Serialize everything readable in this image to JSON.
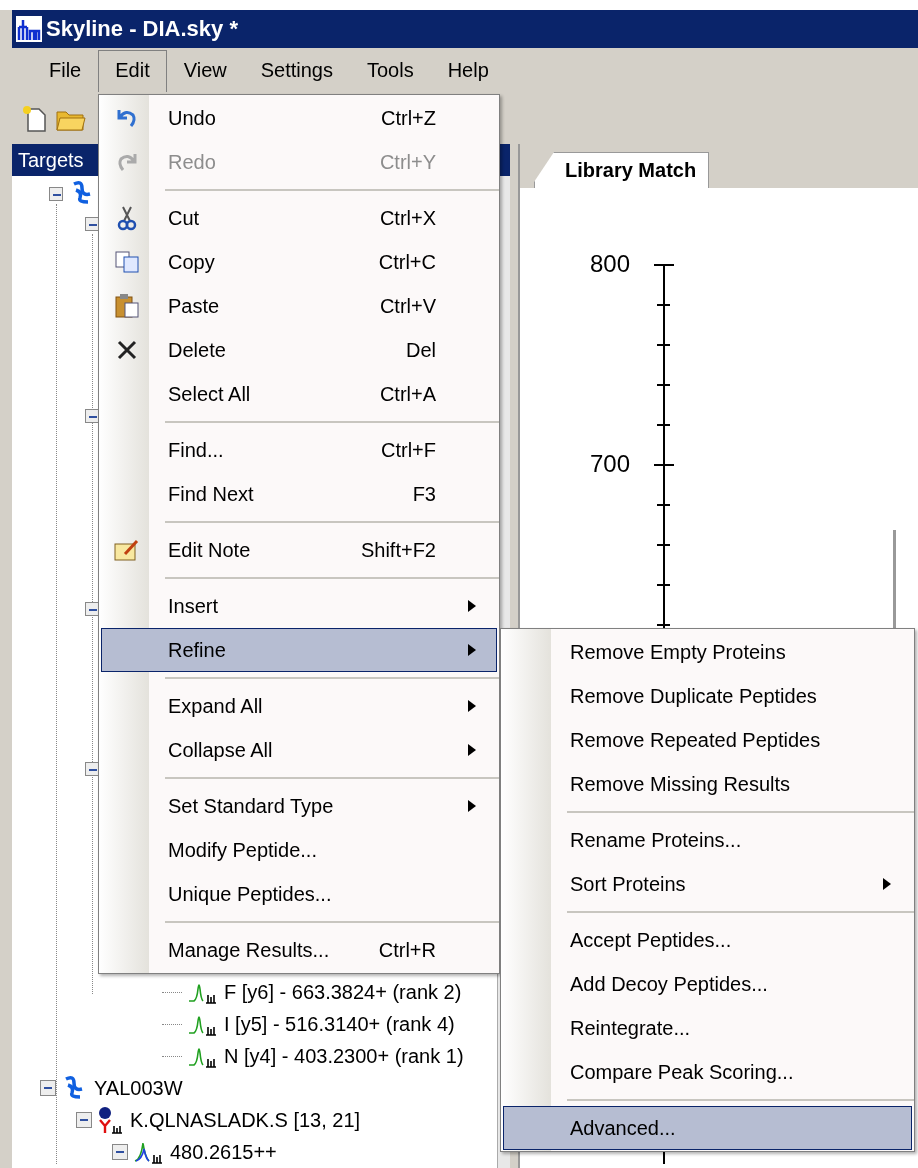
{
  "window": {
    "title": "Skyline - DIA.sky *"
  },
  "menu_bar": [
    {
      "label": "File",
      "selected": false
    },
    {
      "label": "Edit",
      "selected": true
    },
    {
      "label": "View",
      "selected": false
    },
    {
      "label": "Settings",
      "selected": false
    },
    {
      "label": "Tools",
      "selected": false
    },
    {
      "label": "Help",
      "selected": false
    }
  ],
  "targets_panel": {
    "title": "Targets",
    "tree": [
      {
        "kind": "transition",
        "label": "F [y6] - 663.3824+ (rank 2)"
      },
      {
        "kind": "transition",
        "label": "I [y5] - 516.3140+ (rank 4)"
      },
      {
        "kind": "transition",
        "label": "N [y4] - 403.2300+ (rank 1)"
      },
      {
        "kind": "protein",
        "label": "YAL003W",
        "expanded": true,
        "children": [
          {
            "kind": "peptide",
            "label": "K.QLNASLADK.S [13, 21]",
            "expanded": true,
            "children": [
              {
                "kind": "precursor",
                "label": "480.2615++",
                "expanded": true
              }
            ]
          }
        ]
      }
    ]
  },
  "graph_panel": {
    "tab": "Library Match",
    "axis_ticks": [
      "800",
      "700"
    ]
  },
  "edit_menu": [
    {
      "kind": "command",
      "label": "Undo",
      "shortcut": "Ctrl+Z",
      "disabled": false,
      "selected": false
    },
    {
      "kind": "command",
      "label": "Redo",
      "shortcut": "Ctrl+Y",
      "disabled": true,
      "selected": false
    },
    {
      "kind": "separator"
    },
    {
      "kind": "command",
      "label": "Cut",
      "shortcut": "Ctrl+X",
      "disabled": false,
      "selected": false
    },
    {
      "kind": "command",
      "label": "Copy",
      "shortcut": "Ctrl+C",
      "disabled": false,
      "selected": false
    },
    {
      "kind": "command",
      "label": "Paste",
      "shortcut": "Ctrl+V",
      "disabled": false,
      "selected": false
    },
    {
      "kind": "command",
      "label": "Delete",
      "shortcut": "Del",
      "disabled": false,
      "selected": false
    },
    {
      "kind": "command",
      "label": "Select All",
      "shortcut": "Ctrl+A",
      "disabled": false,
      "selected": false
    },
    {
      "kind": "separator"
    },
    {
      "kind": "command",
      "label": "Find...",
      "shortcut": "Ctrl+F",
      "disabled": false,
      "selected": false
    },
    {
      "kind": "command",
      "label": "Find Next",
      "shortcut": "F3",
      "disabled": false,
      "selected": false
    },
    {
      "kind": "separator"
    },
    {
      "kind": "command",
      "label": "Edit Note",
      "shortcut": "Shift+F2",
      "disabled": false,
      "selected": false
    },
    {
      "kind": "separator"
    },
    {
      "kind": "submenu",
      "label": "Insert",
      "disabled": false,
      "selected": false
    },
    {
      "kind": "submenu",
      "label": "Refine",
      "disabled": false,
      "selected": true
    },
    {
      "kind": "separator"
    },
    {
      "kind": "submenu",
      "label": "Expand All",
      "disabled": false,
      "selected": false
    },
    {
      "kind": "submenu",
      "label": "Collapse All",
      "disabled": false,
      "selected": false
    },
    {
      "kind": "separator"
    },
    {
      "kind": "submenu",
      "label": "Set Standard Type",
      "disabled": false,
      "selected": false
    },
    {
      "kind": "command",
      "label": "Modify Peptide...",
      "disabled": false,
      "selected": false
    },
    {
      "kind": "command",
      "label": "Unique Peptides...",
      "disabled": false,
      "selected": false
    },
    {
      "kind": "separator"
    },
    {
      "kind": "command",
      "label": "Manage Results...",
      "shortcut": "Ctrl+R",
      "disabled": false,
      "selected": false
    }
  ],
  "refine_menu": [
    {
      "kind": "command",
      "label": "Remove Empty Proteins",
      "selected": false
    },
    {
      "kind": "command",
      "label": "Remove Duplicate Peptides",
      "selected": false
    },
    {
      "kind": "command",
      "label": "Remove Repeated Peptides",
      "selected": false
    },
    {
      "kind": "command",
      "label": "Remove Missing Results",
      "selected": false
    },
    {
      "kind": "separator"
    },
    {
      "kind": "command",
      "label": "Rename Proteins...",
      "selected": false
    },
    {
      "kind": "submenu",
      "label": "Sort Proteins",
      "selected": false
    },
    {
      "kind": "separator"
    },
    {
      "kind": "command",
      "label": "Accept Peptides...",
      "selected": false
    },
    {
      "kind": "command",
      "label": "Add Decoy Peptides...",
      "selected": false
    },
    {
      "kind": "command",
      "label": "Reintegrate...",
      "selected": false
    },
    {
      "kind": "command",
      "label": "Compare Peak Scoring...",
      "selected": false
    },
    {
      "kind": "separator"
    },
    {
      "kind": "command",
      "label": "Advanced...",
      "selected": true
    }
  ]
}
